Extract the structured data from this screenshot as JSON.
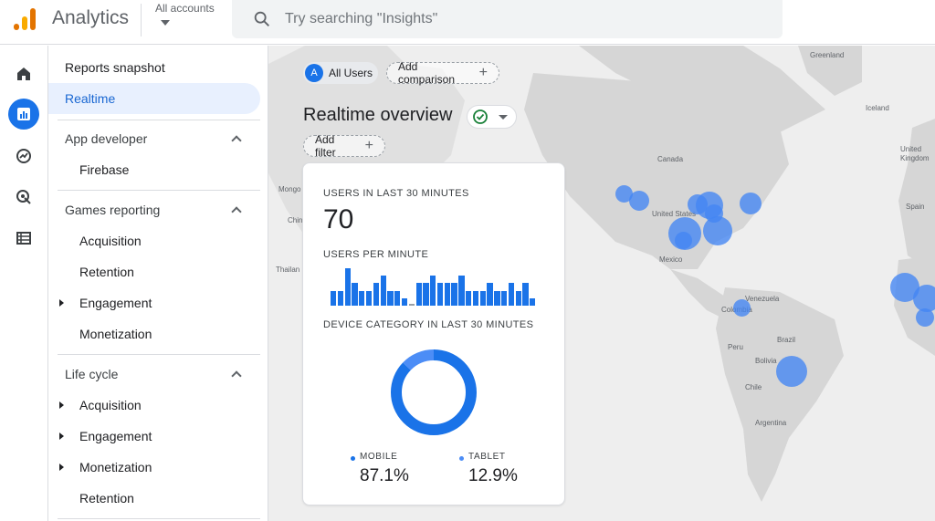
{
  "header": {
    "app_title": "Analytics",
    "account_label": "All accounts",
    "search_placeholder": "Try searching \"Insights\""
  },
  "rail": {
    "icons": [
      "home-icon",
      "reports-icon",
      "explore-icon",
      "advertising-icon",
      "configure-icon"
    ],
    "active_index": 1
  },
  "nav": {
    "reports_snapshot": "Reports snapshot",
    "realtime": "Realtime",
    "app_developer": "App developer",
    "firebase": "Firebase",
    "games_reporting": "Games reporting",
    "games_items": [
      "Acquisition",
      "Retention",
      "Engagement",
      "Monetization"
    ],
    "life_cycle": "Life cycle",
    "life_items": [
      "Acquisition",
      "Engagement",
      "Monetization",
      "Retention"
    ]
  },
  "main": {
    "all_users_avatar": "A",
    "all_users": "All Users",
    "add_comparison": "Add comparison",
    "title": "Realtime overview",
    "add_filter": "Add filter",
    "map_labels": {
      "greenland": "Greenland",
      "iceland": "Iceland",
      "canada": "Canada",
      "united_states": "United States",
      "mexico": "Mexico",
      "venezuela": "Venezuela",
      "colombia": "Colombia",
      "peru": "Peru",
      "brazil": "Brazil",
      "bolivia": "Bolivia",
      "chile": "Chile",
      "argentina": "Argentina",
      "united_kingdom": "United\nKingdom",
      "spain": "Spain",
      "mongolia": "Mongo",
      "china": "Chin",
      "thailand": "Thailan"
    }
  },
  "card": {
    "users_label": "USERS IN LAST 30 MINUTES",
    "users_value": "70",
    "per_minute_label": "USERS PER MINUTE",
    "per_minute_values": [
      2,
      2,
      5,
      3,
      2,
      2,
      3,
      4,
      2,
      2,
      1,
      0,
      3,
      3,
      4,
      3,
      3,
      3,
      4,
      2,
      2,
      2,
      3,
      2,
      2,
      3,
      2,
      3,
      1
    ],
    "device_label": "DEVICE CATEGORY IN LAST 30 MINUTES",
    "device_segments": [
      {
        "name": "MOBILE",
        "value": "87.1%",
        "fraction": 0.871,
        "color": "#1a73e8"
      },
      {
        "name": "TABLET",
        "value": "12.9%",
        "fraction": 0.129,
        "color": "#4c8df6"
      }
    ]
  },
  "colors": {
    "accent": "#1a73e8",
    "bubble": "#4285f4"
  }
}
